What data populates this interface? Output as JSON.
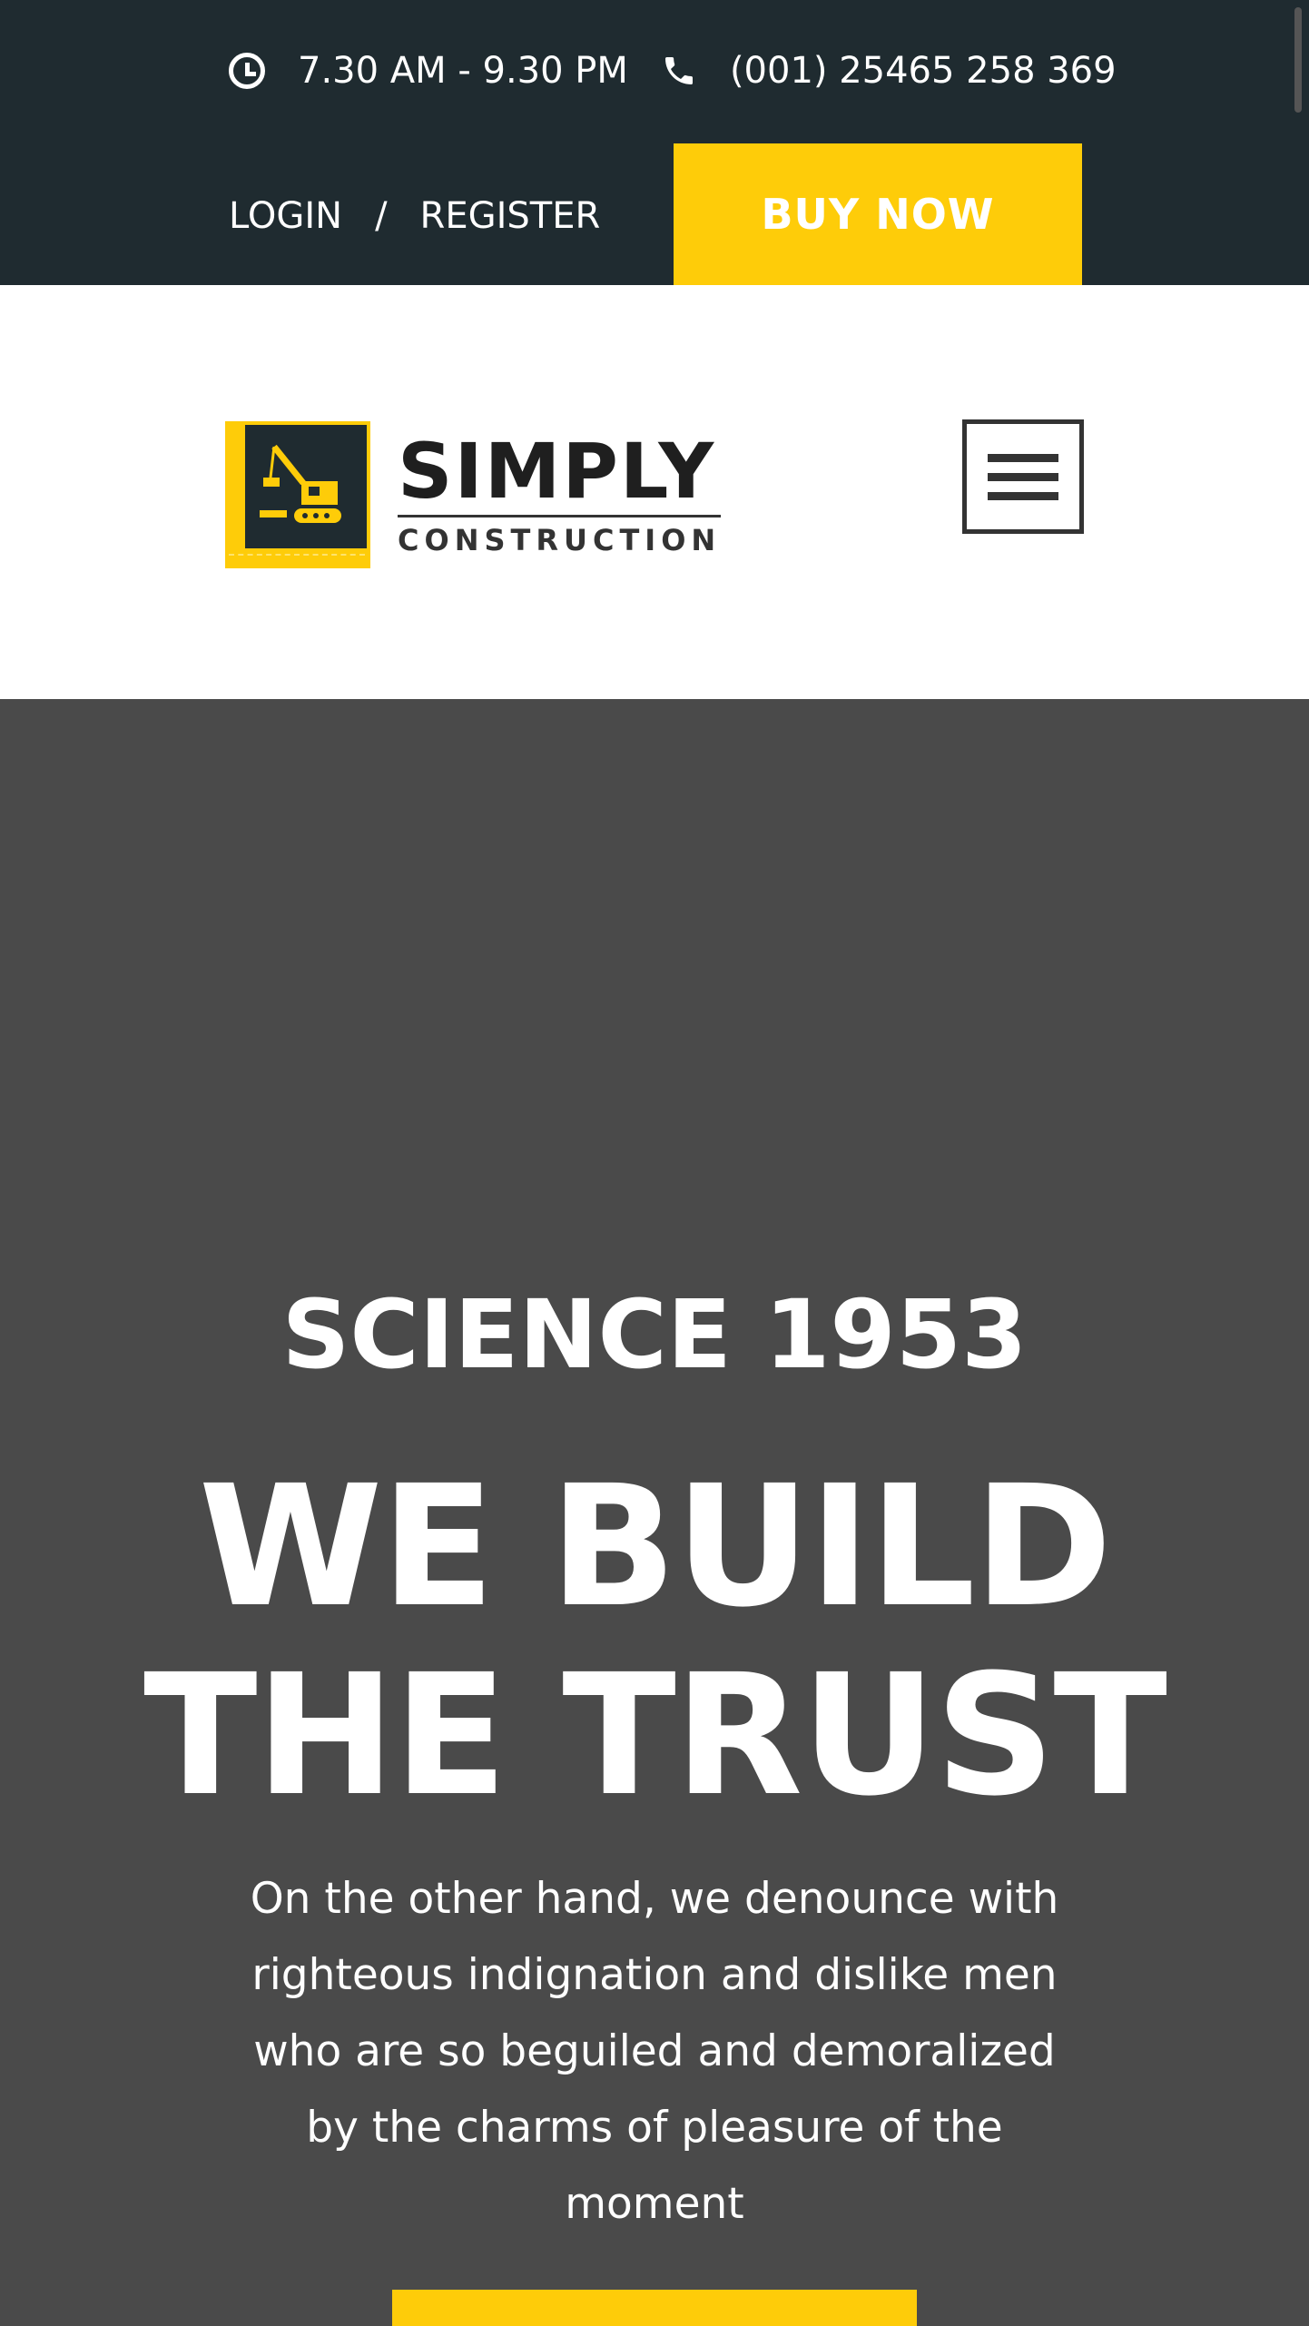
{
  "topbar": {
    "hours": "7.30 AM - 9.30 PM",
    "phone": "(001) 25465 258 369",
    "login_label": "LOGIN",
    "separator": "/",
    "register_label": "REGISTER",
    "buy_label": "BUY NOW"
  },
  "header": {
    "logo_title": "SIMPLY",
    "logo_subtitle": "CONSTRUCTION"
  },
  "hero": {
    "eyebrow": "SCIENCE 1953",
    "title_line1": "WE BUILD",
    "title_line2": "THE TRUST",
    "text": "On the other hand, we denounce with righteous indignation and dislike men who are so beguiled and demoralized by the charms of pleasure of the moment"
  },
  "icons": {
    "clock": "clock-icon",
    "phone": "phone-icon",
    "menu": "hamburger-icon",
    "logo": "crane-logo-icon"
  },
  "colors": {
    "topbar_bg": "#1f2b30",
    "accent": "#fecc09",
    "hero_bg": "#4a4a4a",
    "header_bg": "#ffffff"
  }
}
